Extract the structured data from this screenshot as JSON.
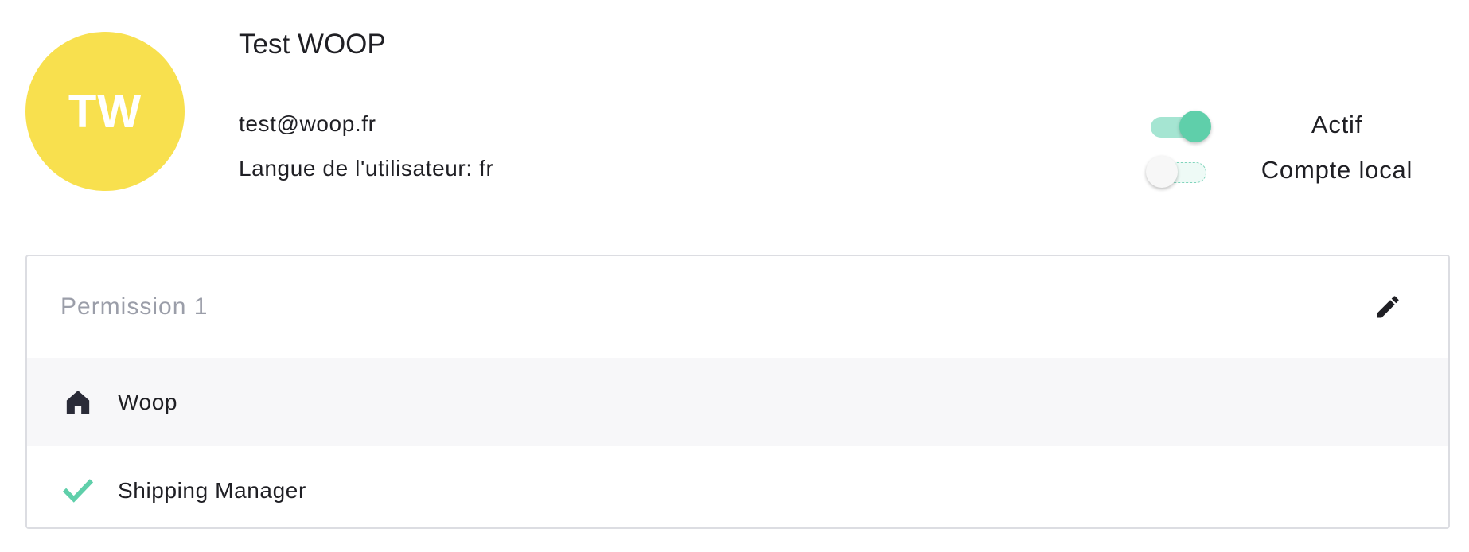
{
  "user": {
    "initials": "TW",
    "name": "Test WOOP",
    "email": "test@woop.fr",
    "language_line": "Langue de l'utilisateur: fr",
    "avatar_color": "#f8e04e"
  },
  "toggles": {
    "active": {
      "label": "Actif",
      "checked": true
    },
    "local_account": {
      "label": "Compte local",
      "checked": false
    },
    "accent_color": "#5fcfaa"
  },
  "permission": {
    "title": "Permission 1",
    "edit_icon": "pencil-icon",
    "items": [
      {
        "label": "Woop",
        "icon": "home-icon"
      },
      {
        "label": "Shipping Manager",
        "icon": "check-icon"
      }
    ]
  }
}
